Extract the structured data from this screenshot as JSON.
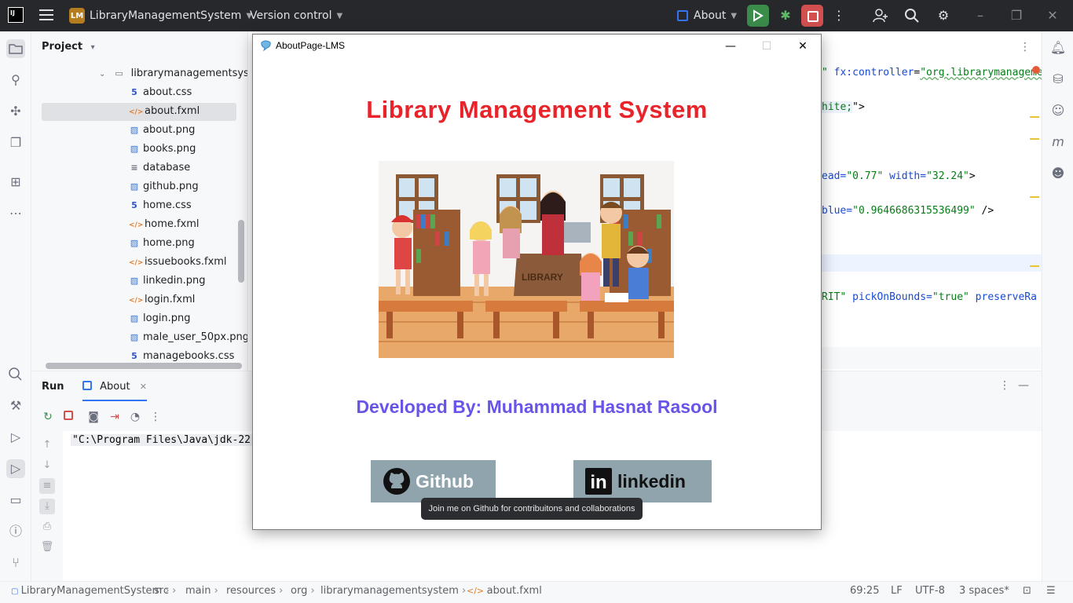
{
  "titlebar": {
    "logo_text": "IJ",
    "project_badge": "LM",
    "project_name": "LibraryManagementSystem",
    "version_control": "Version control",
    "run_config": "About"
  },
  "project_panel": {
    "header": "Project",
    "folder": "librarymanagementsyste",
    "files": [
      {
        "name": "about.css",
        "type": "css"
      },
      {
        "name": "about.fxml",
        "type": "xml"
      },
      {
        "name": "about.png",
        "type": "png"
      },
      {
        "name": "books.png",
        "type": "png"
      },
      {
        "name": "database",
        "type": "db"
      },
      {
        "name": "github.png",
        "type": "png"
      },
      {
        "name": "home.css",
        "type": "css"
      },
      {
        "name": "home.fxml",
        "type": "xml"
      },
      {
        "name": "home.png",
        "type": "png"
      },
      {
        "name": "issuebooks.fxml",
        "type": "xml"
      },
      {
        "name": "linkedin.png",
        "type": "png"
      },
      {
        "name": "login.fxml",
        "type": "xml"
      },
      {
        "name": "login.png",
        "type": "png"
      },
      {
        "name": "male_user_50px.png",
        "type": "png"
      },
      {
        "name": "managebooks.css",
        "type": "css"
      }
    ]
  },
  "editor": {
    "line1_attr": "fx:controller",
    "line1_eq": "=",
    "line1_val": "\"org.librarymanageme",
    "line2_val": "hite;",
    "line2_end": "\">",
    "line3_pre": "ead=",
    "line3_val": "\"0.77\"",
    "line3_attr": " width=",
    "line3_val2": "\"32.24\"",
    "line3_end": ">",
    "line4_pre": "blue=",
    "line4_val": "\"0.9646686315536499\"",
    "line4_end": " />",
    "line5_val": "RIT\"",
    "line5_attr": " pickOnBounds=",
    "line5_val2": "\"true\"",
    "line5_attr2": " preserveRa"
  },
  "run_panel": {
    "run_label": "Run",
    "tab_label": "About",
    "console_text": "\"C:\\Program Files\\Java\\jdk-22"
  },
  "app_window": {
    "title": "AboutPage-LMS",
    "heading": "Library Management System",
    "developed_by": "Developed By: Muhammad Hasnat Rasool",
    "github_label": "Github",
    "linkedin_label": "linkedin",
    "linkedin_logo": "in",
    "illustration_sign": "LIBRARY",
    "tooltip": "Join me on Github for contribuitons and collaborations"
  },
  "statusbar": {
    "crumbs": [
      "LibraryManagementSystem",
      "src",
      "main",
      "resources",
      "org",
      "librarymanagementsystem",
      "about.fxml"
    ],
    "position": "69:25",
    "line_sep": "LF",
    "encoding": "UTF-8",
    "indent": "3 spaces*"
  },
  "colors": {
    "heading": "#e8232a",
    "developed_by": "#6655e8",
    "button_bg": "#90a4ae",
    "titlebar_bg": "#27282c"
  }
}
